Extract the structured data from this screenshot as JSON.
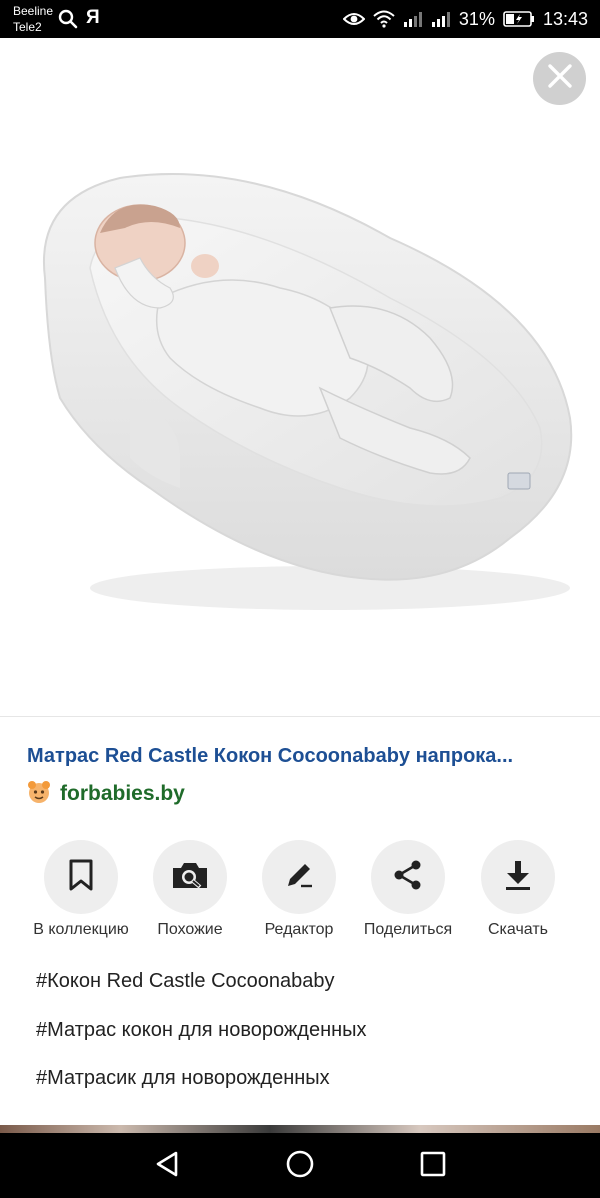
{
  "status_bar": {
    "carrier_1": "Beeline",
    "carrier_2": "Tele2",
    "ya_label": "Я",
    "battery_percent": "31%",
    "time": "13:43"
  },
  "viewer": {
    "title": "Матрас Red Castle Кокон Cocoonababy напрока...",
    "source": "forbabies.by"
  },
  "actions": [
    {
      "label": "В коллекцию",
      "icon": "bookmark-icon"
    },
    {
      "label": "Похожие",
      "icon": "camera-search-icon"
    },
    {
      "label": "Редактор",
      "icon": "pencil-icon"
    },
    {
      "label": "Поделиться",
      "icon": "share-icon"
    },
    {
      "label": "Скачать",
      "icon": "download-icon"
    }
  ],
  "tags": [
    "#Кокон Red Castle Cocoonababy",
    "#Матрас кокон для новорожденных",
    "#Матрасик для новорожденных"
  ],
  "colors": {
    "title": "#1d4f94",
    "source": "#1f6b2a",
    "action_circle": "#eeeeee",
    "close_button": "#d0d0d0"
  }
}
